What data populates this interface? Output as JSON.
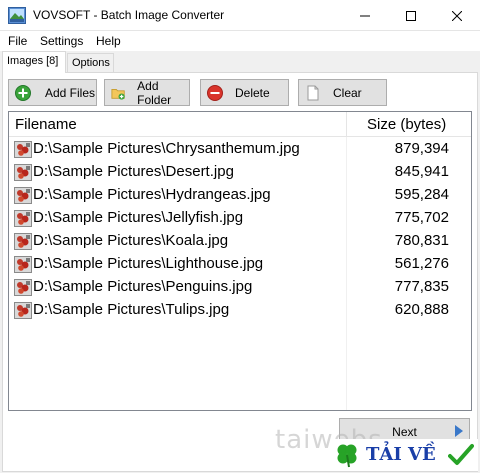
{
  "window": {
    "title": "VOVSOFT - Batch Image Converter",
    "icons": {
      "app": "app-icon",
      "minimize": "minimize-icon",
      "maximize": "maximize-icon",
      "close": "close-icon"
    }
  },
  "menu": {
    "items": [
      "File",
      "Settings",
      "Help"
    ]
  },
  "tabs": [
    {
      "label": "Images [8]",
      "active": true
    },
    {
      "label": "Options",
      "active": false
    }
  ],
  "toolbar": {
    "add_files": "Add Files",
    "add_folder": "Add Folder",
    "delete": "Delete",
    "clear": "Clear"
  },
  "list": {
    "columns": [
      "Filename",
      "Size (bytes)"
    ],
    "rows": [
      {
        "filename": "D:\\Sample Pictures\\Chrysanthemum.jpg",
        "size": "879,394"
      },
      {
        "filename": "D:\\Sample Pictures\\Desert.jpg",
        "size": "845,941"
      },
      {
        "filename": "D:\\Sample Pictures\\Hydrangeas.jpg",
        "size": "595,284"
      },
      {
        "filename": "D:\\Sample Pictures\\Jellyfish.jpg",
        "size": "775,702"
      },
      {
        "filename": "D:\\Sample Pictures\\Koala.jpg",
        "size": "780,831"
      },
      {
        "filename": "D:\\Sample Pictures\\Lighthouse.jpg",
        "size": "561,276"
      },
      {
        "filename": "D:\\Sample Pictures\\Penguins.jpg",
        "size": "777,835"
      },
      {
        "filename": "D:\\Sample Pictures\\Tulips.jpg",
        "size": "620,888"
      }
    ]
  },
  "footer": {
    "next": "Next"
  },
  "watermark": {
    "text": "taiwebs",
    "badge": "TẢI VỀ"
  },
  "colors": {
    "accent": "#3a78c9",
    "add_green": "#3aa33a",
    "delete_red": "#d9342b",
    "badge_blue": "#1a3fa8"
  }
}
